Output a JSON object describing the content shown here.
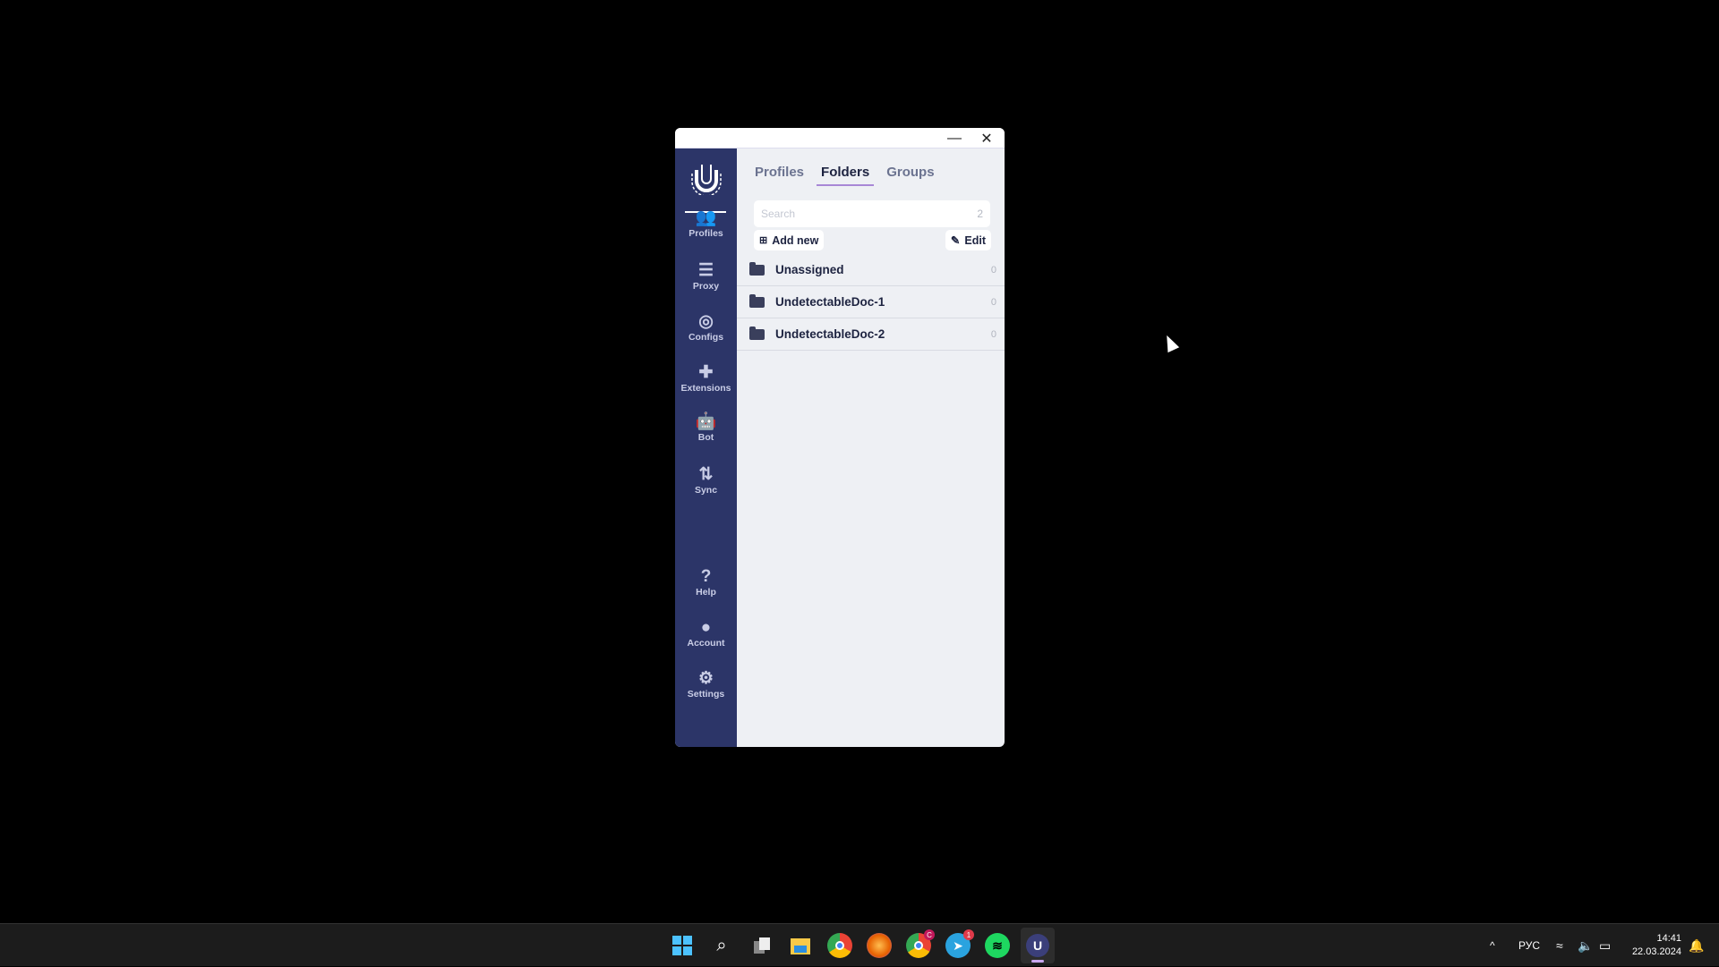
{
  "window": {
    "minimize": "—",
    "close": "✕"
  },
  "sidebar": {
    "items": [
      {
        "label": "Profiles",
        "icon": "users-gear-icon",
        "glyph": "👥"
      },
      {
        "label": "Proxy",
        "icon": "server-icon",
        "glyph": "☰"
      },
      {
        "label": "Configs",
        "icon": "fingerprint-icon",
        "glyph": "◎"
      },
      {
        "label": "Extensions",
        "icon": "puzzle-icon",
        "glyph": "✚"
      },
      {
        "label": "Bot",
        "icon": "robot-icon",
        "glyph": "🤖"
      },
      {
        "label": "Sync",
        "icon": "sync-icon",
        "glyph": "⇅"
      }
    ],
    "bottom": [
      {
        "label": "Help",
        "icon": "question-icon",
        "glyph": "?"
      },
      {
        "label": "Account",
        "icon": "user-circle-icon",
        "glyph": "●"
      },
      {
        "label": "Settings",
        "icon": "gear-icon",
        "glyph": "⚙"
      }
    ]
  },
  "tabs": [
    "Profiles",
    "Folders",
    "Groups"
  ],
  "active_tab": "Folders",
  "search": {
    "placeholder": "Search",
    "count": "2"
  },
  "buttons": {
    "add_new": "Add new",
    "edit": "Edit"
  },
  "folders": [
    {
      "name": "Unassigned",
      "count": "0"
    },
    {
      "name": "UndetectableDoc-1",
      "count": "0"
    },
    {
      "name": "UndetectableDoc-2",
      "count": "0"
    }
  ],
  "taskbar": {
    "apps": [
      "start",
      "search",
      "task-view",
      "file-explorer",
      "chrome",
      "firefox",
      "chrome-profile",
      "telegram",
      "spotify",
      "undetectable"
    ],
    "chrome_badge": "C",
    "telegram_badge": "1",
    "lang": "РУС",
    "time": "14:41",
    "date": "22.03.2024"
  },
  "colors": {
    "sidebar": "#2c3568",
    "accent": "#a887d6"
  }
}
